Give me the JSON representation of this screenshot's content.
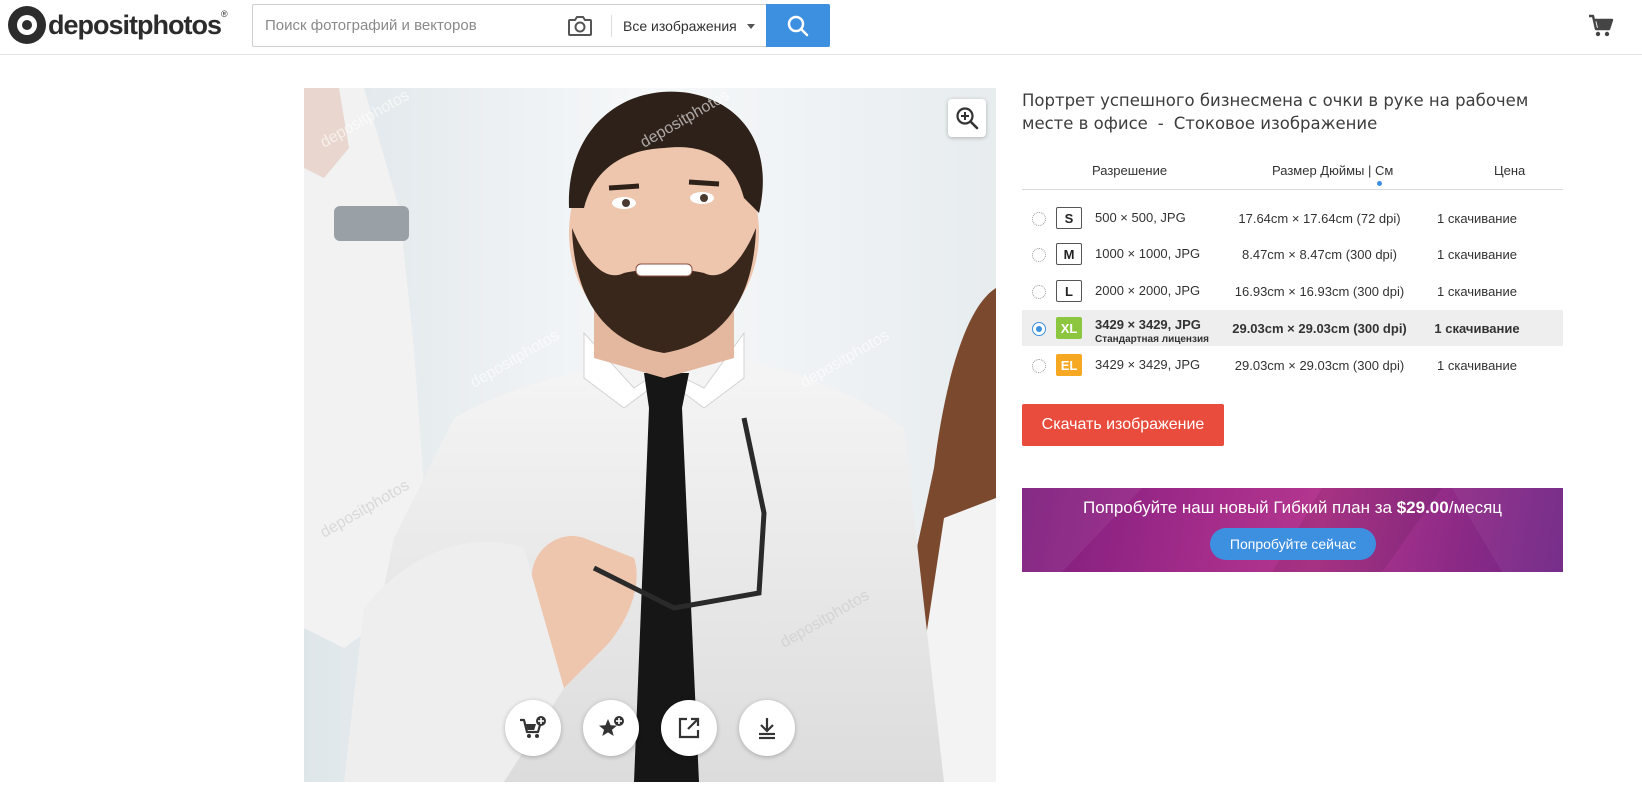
{
  "header": {
    "logo_text": "depositphotos",
    "logo_reg": "®",
    "search": {
      "placeholder": "Поиск фотографий и векторов",
      "value": ""
    },
    "search_type": "Все изображения"
  },
  "product": {
    "title": "Портрет успешного бизнесмена с очки в руке на рабочем месте в офисе",
    "title_sep": "-",
    "title_suffix": "Стоковое изображение"
  },
  "table": {
    "headers": {
      "resolution": "Разрешение",
      "size": "Размер Дюймы | См",
      "price": "Цена"
    },
    "rows": [
      {
        "badge": "S",
        "resolution": "500 × 500, JPG",
        "sub": "",
        "dimensions": "17.64cm × 17.64cm (72 dpi)",
        "price": "1 скачивание",
        "selected": false
      },
      {
        "badge": "M",
        "resolution": "1000 × 1000, JPG",
        "sub": "",
        "dimensions": "8.47cm × 8.47cm (300 dpi)",
        "price": "1 скачивание",
        "selected": false
      },
      {
        "badge": "L",
        "resolution": "2000 × 2000, JPG",
        "sub": "",
        "dimensions": "16.93cm × 16.93cm (300 dpi)",
        "price": "1 скачивание",
        "selected": false
      },
      {
        "badge": "XL",
        "resolution": "3429 × 3429, JPG",
        "sub": "Стандартная лицензия",
        "dimensions": "29.03cm × 29.03cm (300 dpi)",
        "price": "1 скачивание",
        "selected": true
      },
      {
        "badge": "EL",
        "resolution": "3429 × 3429, JPG",
        "sub": "",
        "dimensions": "29.03cm × 29.03cm (300 dpi)",
        "price": "1 скачивание",
        "selected": false
      }
    ]
  },
  "download_button": "Скачать изображение",
  "promo": {
    "text_before": "Попробуйте наш новый Гибкий план за",
    "price": "$29.00",
    "text_after": "/месяц",
    "button": "Попробуйте сейчас"
  },
  "colors": {
    "accent_blue": "#3d8fe0",
    "download_red": "#e94c3d",
    "badge_xl": "#8cc63f",
    "badge_el": "#f7a823"
  },
  "icons": [
    "camera-icon",
    "search-icon",
    "cart-icon",
    "zoom-icon",
    "add-to-cart-icon",
    "add-to-favorites-icon",
    "share-icon",
    "download-icon"
  ]
}
